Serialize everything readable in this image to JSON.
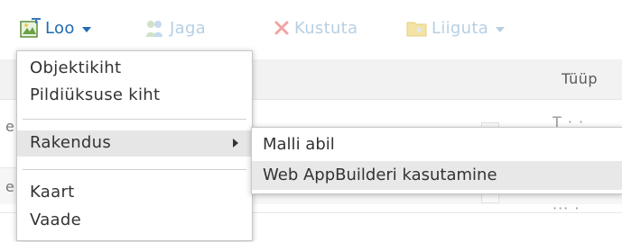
{
  "toolbar": {
    "create_label": "Loo",
    "share_label": "Jaga",
    "delete_label": "Kustuta",
    "move_label": "Liiguta"
  },
  "list": {
    "column_type": "Tüüp"
  },
  "create_menu": {
    "items": [
      {
        "label": "Objektikiht"
      },
      {
        "label": "Pildiüksuse kiht"
      },
      {
        "label": "Rakendus"
      },
      {
        "label": "Kaart"
      },
      {
        "label": "Vaade"
      }
    ]
  },
  "app_submenu": {
    "items": [
      {
        "label": "Malli abil"
      },
      {
        "label": "Web AppBuilderi kasutamine"
      }
    ]
  },
  "colors": {
    "active_link": "#1f6bb3",
    "disabled_link": "#b7cfe3",
    "menu_hover": "#e6e6e6"
  }
}
